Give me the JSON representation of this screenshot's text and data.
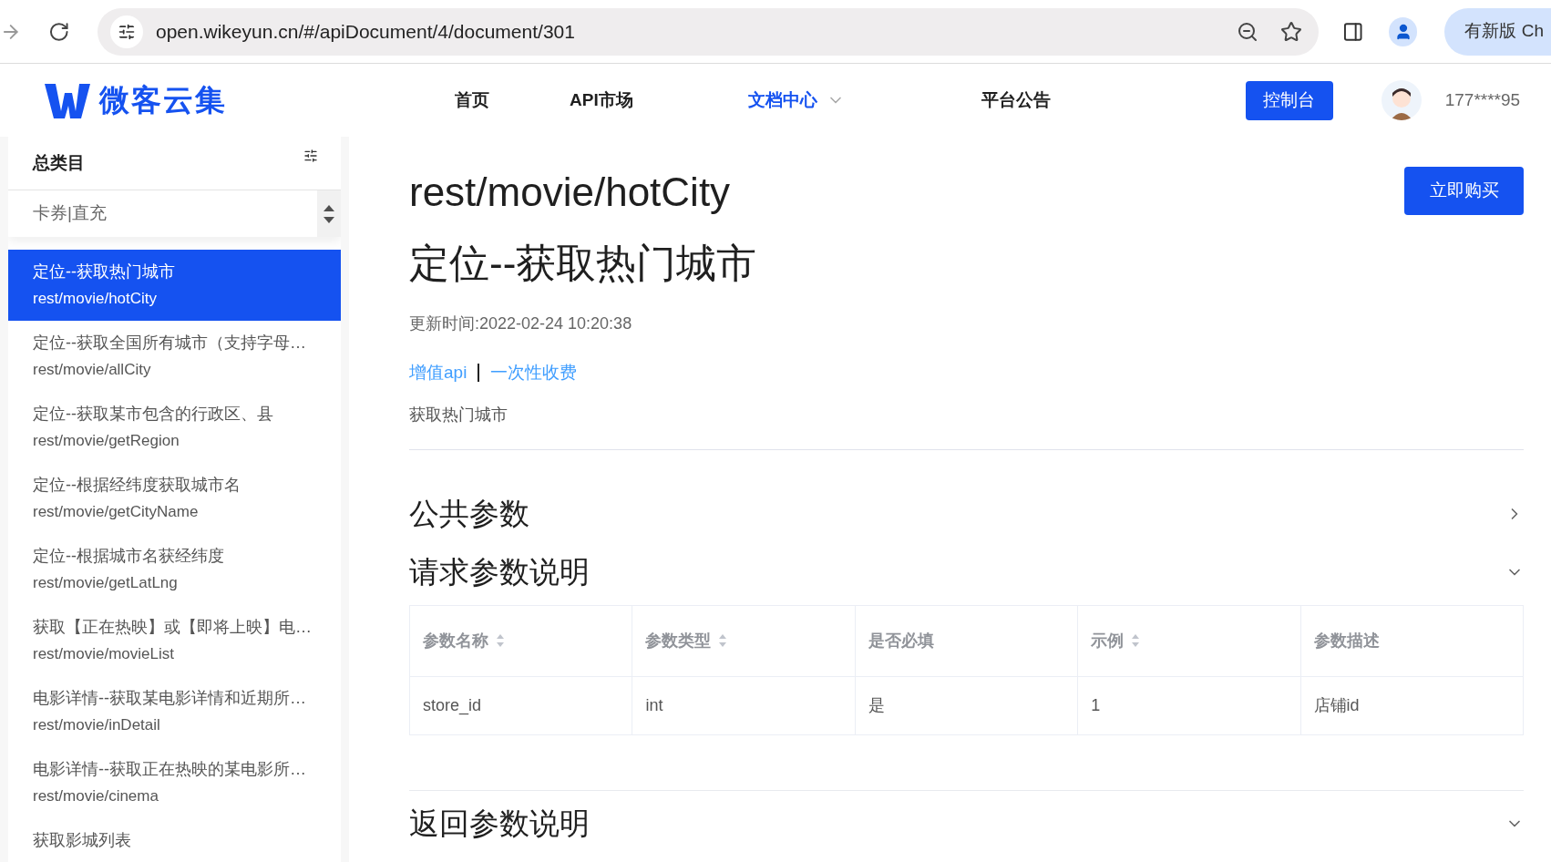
{
  "browser": {
    "url": "open.wikeyun.cn/#/apiDocument/4/document/301",
    "update_button": "有新版 Ch"
  },
  "nav": {
    "logo": "微客云集",
    "items": [
      {
        "label": "首页",
        "selected": false,
        "dropdown": false
      },
      {
        "label": "API市场",
        "selected": false,
        "dropdown": false
      },
      {
        "label": "文档中心",
        "selected": true,
        "dropdown": true
      },
      {
        "label": "平台公告",
        "selected": false,
        "dropdown": false
      }
    ],
    "console_button": "控制台",
    "user": "177****95"
  },
  "sidebar": {
    "title": "总类目",
    "category": "卡券|直充",
    "items": [
      {
        "title": "定位--获取热门城市",
        "path": "rest/movie/hotCity",
        "selected": true
      },
      {
        "title": "定位--获取全国所有城市（支持字母…",
        "path": "rest/movie/allCity",
        "selected": false
      },
      {
        "title": "定位--获取某市包含的行政区、县",
        "path": "rest/movie/getRegion",
        "selected": false
      },
      {
        "title": "定位--根据经纬度获取城市名",
        "path": "rest/movie/getCityName",
        "selected": false
      },
      {
        "title": "定位--根据城市名获经纬度",
        "path": "rest/movie/getLatLng",
        "selected": false
      },
      {
        "title": "获取【正在热映】或【即将上映】电…",
        "path": "rest/movie/movieList",
        "selected": false
      },
      {
        "title": "电影详情--获取某电影详情和近期所…",
        "path": "rest/movie/inDetail",
        "selected": false
      },
      {
        "title": "电影详情--获取正在热映的某电影所…",
        "path": "rest/movie/cinema",
        "selected": false
      },
      {
        "title": "获取影城列表",
        "selected": false
      }
    ]
  },
  "doc": {
    "path": "rest/movie/hotCity",
    "title": "定位--获取热门城市",
    "buy_button": "立即购买",
    "updated": "更新时间:2022-02-24 10:20:38",
    "tags": [
      "增值api",
      "一次性收费"
    ],
    "description": "获取热门城市",
    "sections": [
      {
        "title": "公共参数",
        "expanded": false
      },
      {
        "title": "请求参数说明",
        "expanded": true,
        "table": {
          "columns": [
            {
              "label": "参数名称",
              "sortable": true
            },
            {
              "label": "参数类型",
              "sortable": true
            },
            {
              "label": "是否必填",
              "sortable": false
            },
            {
              "label": "示例",
              "sortable": true
            },
            {
              "label": "参数描述",
              "sortable": false
            }
          ],
          "rows": [
            [
              "store_id",
              "int",
              "是",
              "1",
              "店铺id"
            ]
          ]
        }
      },
      {
        "title": "返回参数说明",
        "expanded": true
      }
    ]
  }
}
